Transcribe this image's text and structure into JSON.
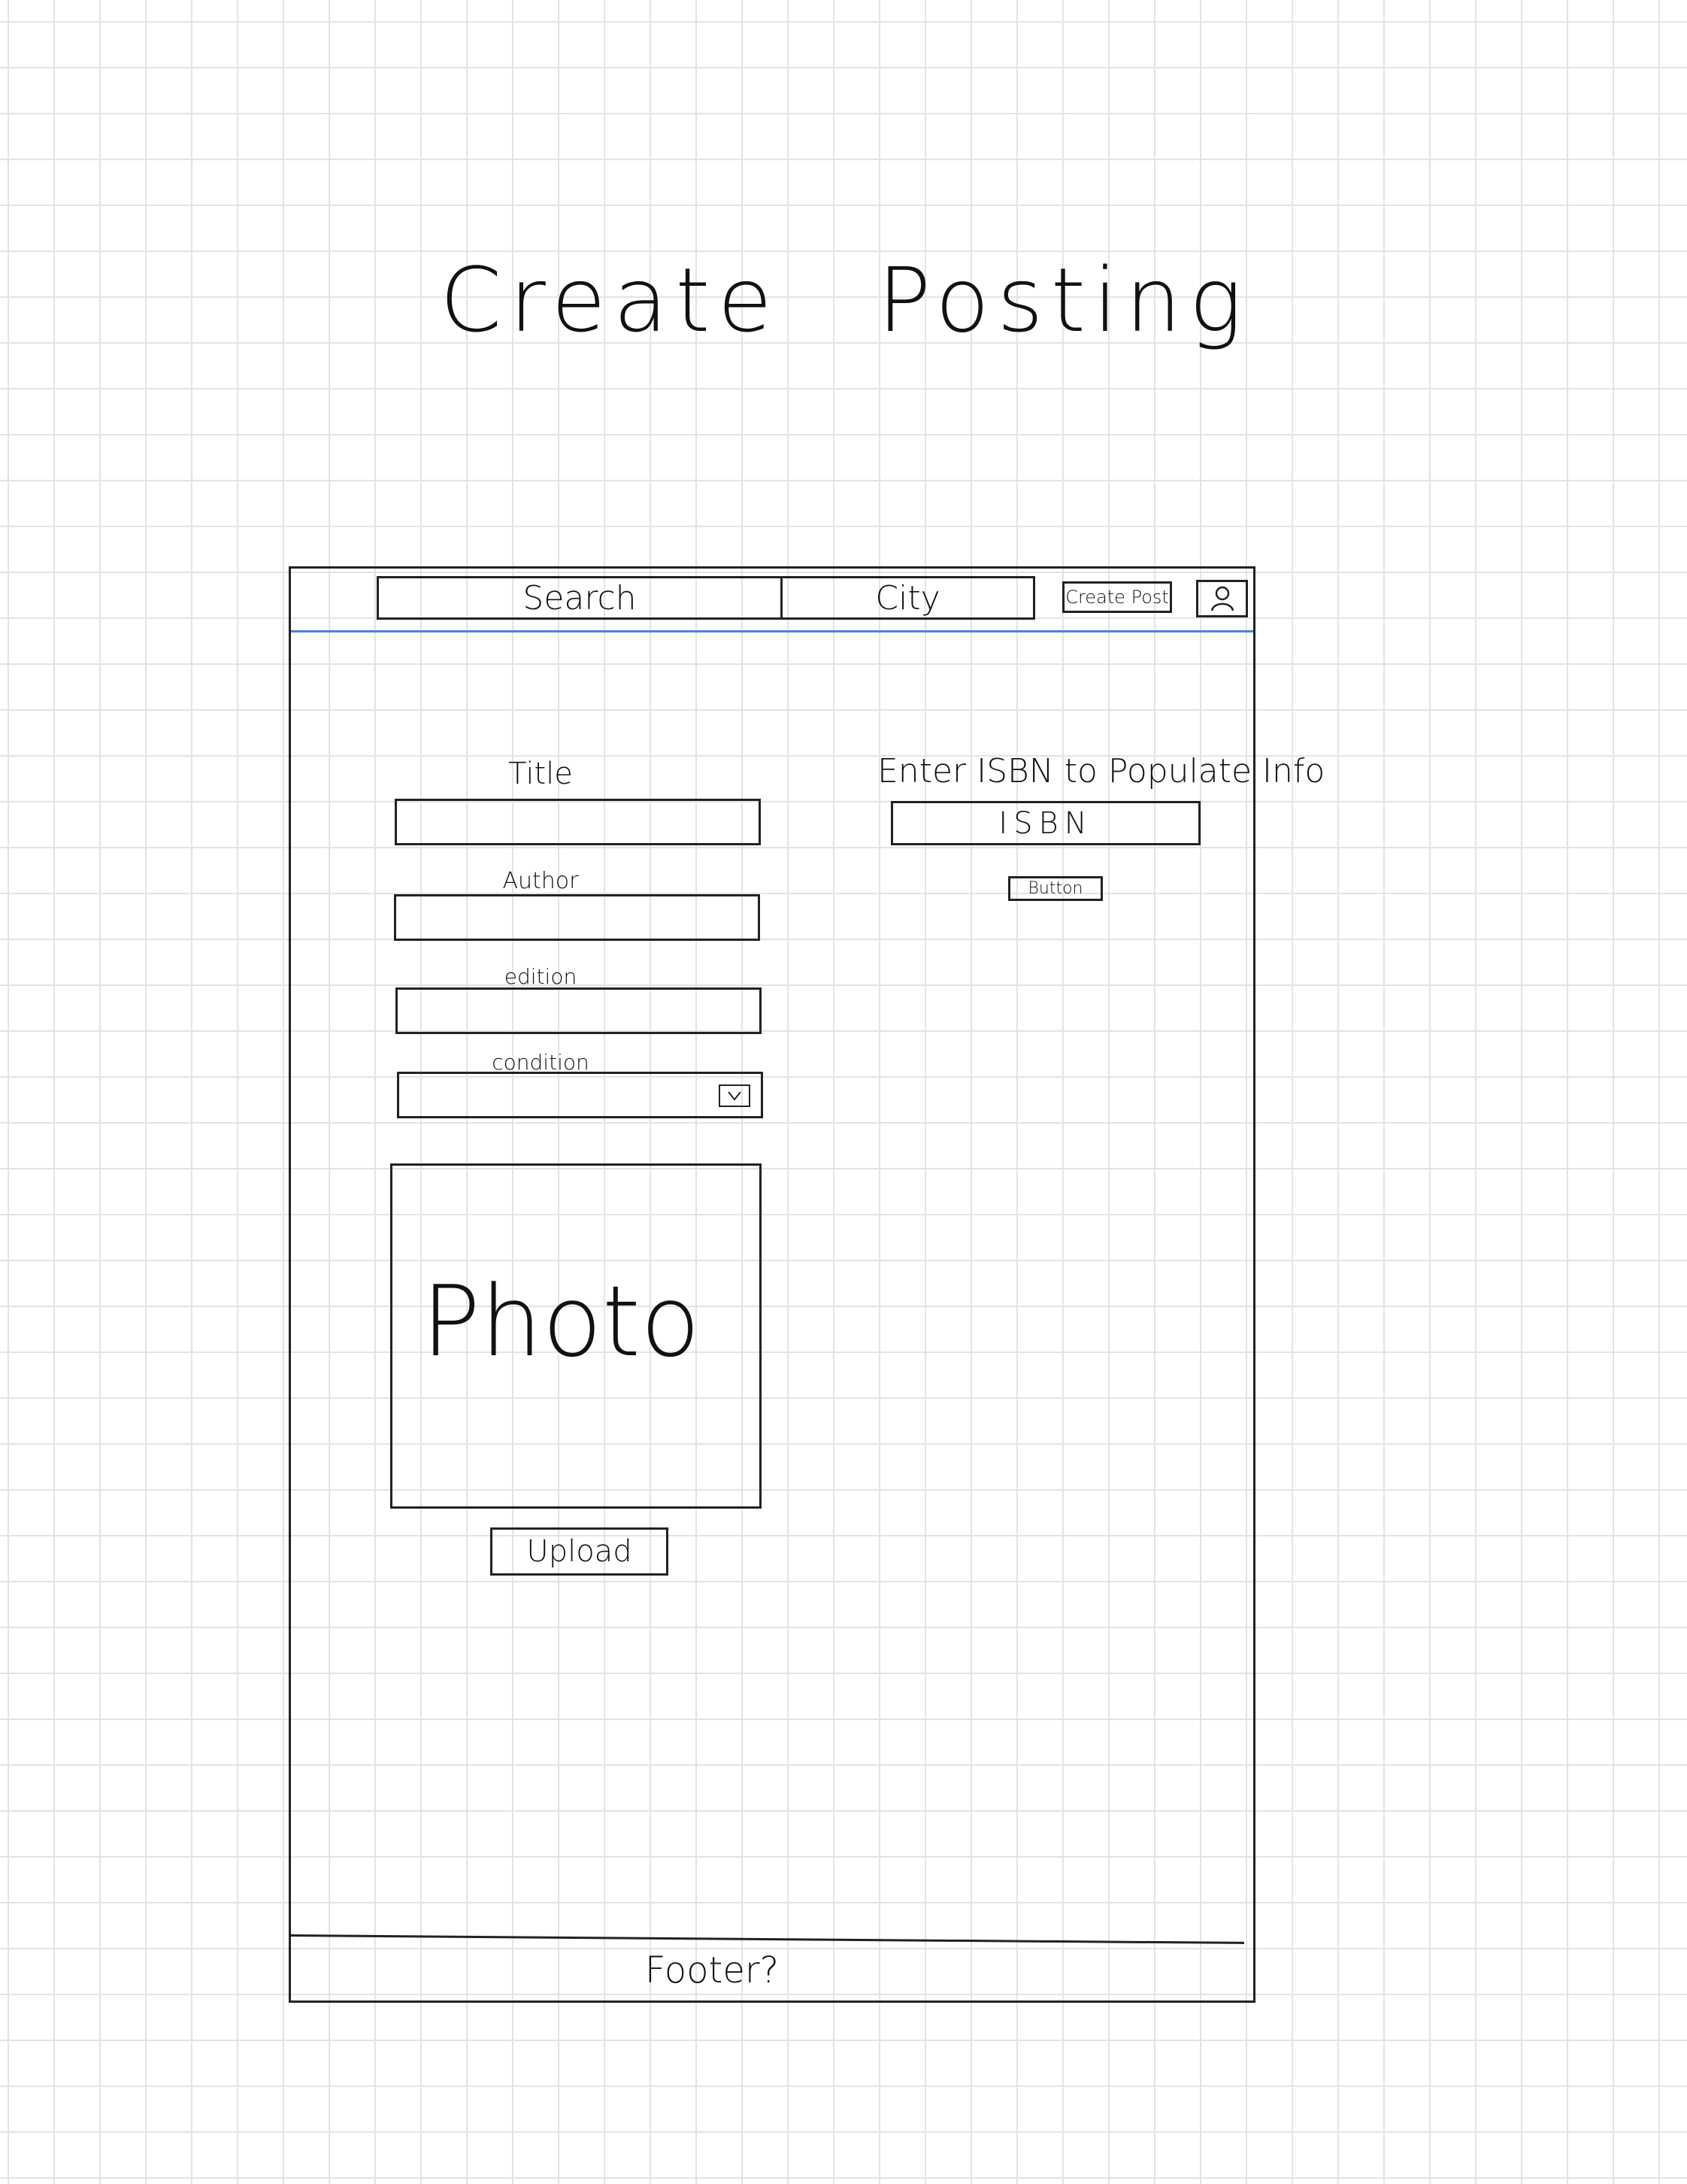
{
  "page_title_words": [
    "Create",
    "Posting"
  ],
  "navbar": {
    "search_label": "Search",
    "city_label": "City",
    "create_post_label": "Create Post",
    "profile_icon": "user-icon"
  },
  "form": {
    "title_label": "Title",
    "author_label": "Author",
    "edition_label": "edition",
    "condition_label": "condition",
    "condition_icon": "checkbox-icon",
    "photo_label": "Photo",
    "upload_label": "Upload"
  },
  "isbn": {
    "heading": "Enter ISBN to Populate Info",
    "field_label": "ISBN",
    "button_label": "Button"
  },
  "footer": {
    "label": "Footer?"
  },
  "colors": {
    "ink": "#222222",
    "nav_divider": "#4a86d8",
    "grid": "#e3e3e3"
  }
}
